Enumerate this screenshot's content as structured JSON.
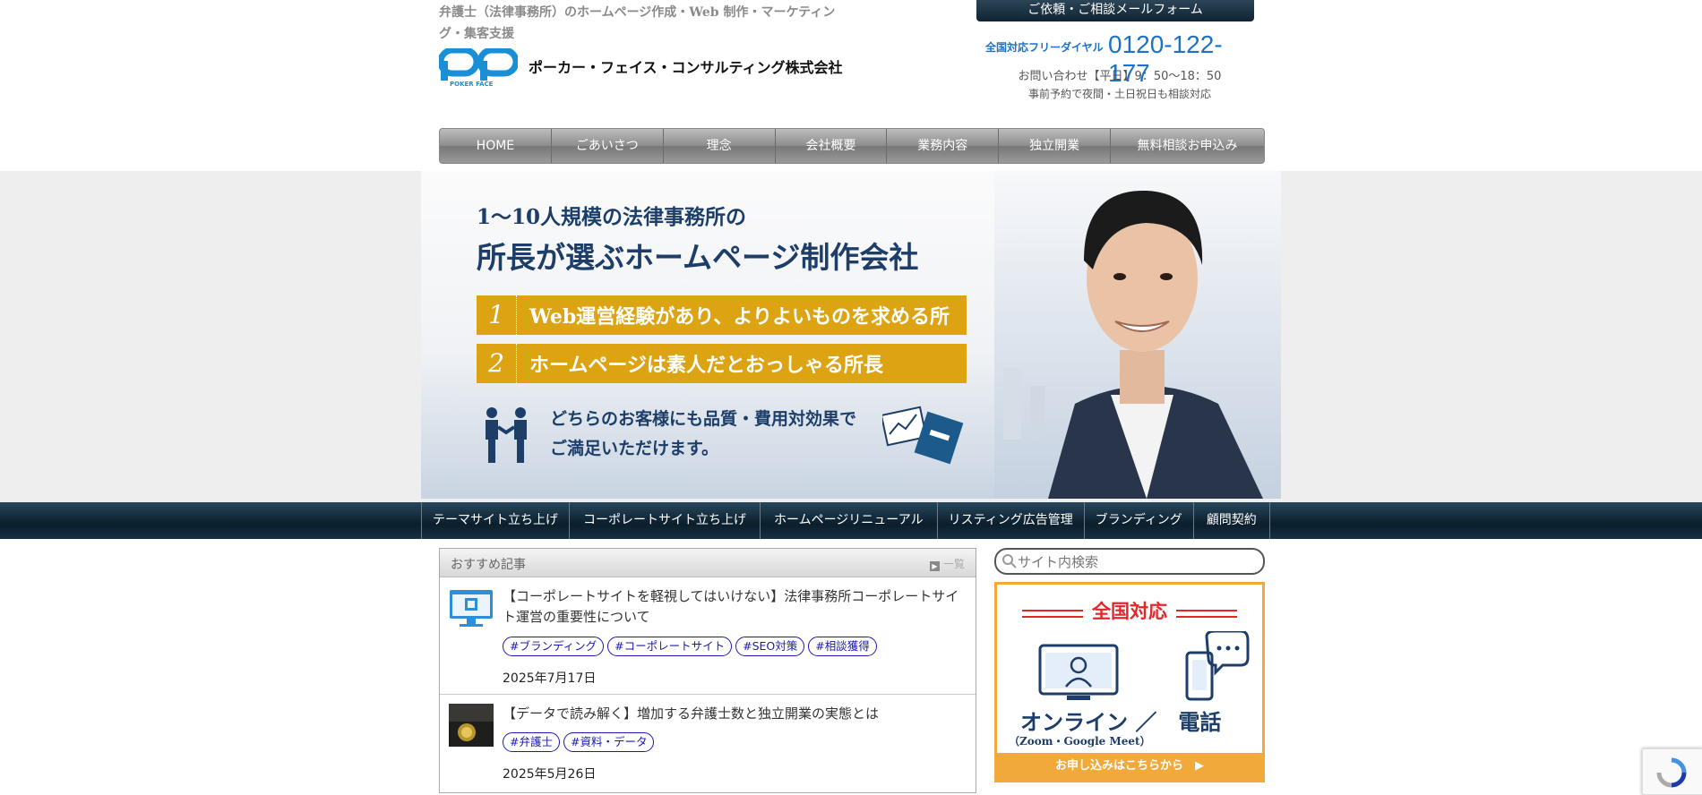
{
  "header": {
    "tagline": "弁護士（法律事務所）のホームページ作成・Web 制作・マーケティング・集客支援",
    "logo_text_top": "PP",
    "logo_text_bottom": "POKER FACE",
    "company_name": "ポーカー・フェイス・コンサルティング株式会社",
    "mail_button": "ご依頼・ご相談メールフォーム",
    "tel_label": "全国対応フリーダイヤル",
    "tel_number": "0120-122-177",
    "hours": "お問い合わせ【平日】9：50〜18：50",
    "hours_note": "事前予約で夜間・土日祝日も相談対応"
  },
  "nav": {
    "items": [
      "HOME",
      "ごあいさつ",
      "理念",
      "会社概要",
      "業務内容",
      "独立開業",
      "無料相談お申込み"
    ]
  },
  "hero": {
    "line1": "1〜10人規模の法律事務所の",
    "line2": "所長が選ぶホームページ制作会社",
    "points": [
      {
        "num": "1",
        "text": "Web運営経験があり、よりよいものを求める所長"
      },
      {
        "num": "2",
        "text": "ホームページは素人だとおっしゃる所長"
      }
    ],
    "closing1": "どちらのお客様にも品質・費用対効果で",
    "closing2": "ご満足いただけます。"
  },
  "categories": [
    "テーマサイト立ち上げ",
    "コーポレートサイト立ち上げ",
    "ホームページリニューアル",
    "リスティング広告管理",
    "ブランディング",
    "顧問契約"
  ],
  "recommended": {
    "title": "おすすめ記事",
    "more": "一覧",
    "posts": [
      {
        "title": "【コーポレートサイトを軽視してはいけない】法律事務所コーポレートサイト運営の重要性について",
        "tags": [
          "#ブランディング",
          "#コーポレートサイト",
          "#SEO対策",
          "#相談獲得"
        ],
        "date": "2025年7月17日"
      },
      {
        "title": "【データで読み解く】増加する弁護士数と独立開業の実態とは",
        "tags": [
          "#弁護士",
          "#資料・データ"
        ],
        "date": "2025年5月26日"
      }
    ]
  },
  "sidebar": {
    "search_placeholder": "サイト内検索",
    "banner_title": "全国対応",
    "banner_main": "オンライン ／　電話",
    "banner_sub": "（Zoom・Google Meet）",
    "banner_cta": "お申し込みはこちらから　▶"
  },
  "colors": {
    "accent_blue": "#1a73c8",
    "navy": "#1c3e69",
    "gold": "#dca413",
    "orange": "#f2a93b",
    "red": "#e3262a",
    "tag_blue": "#1919b3"
  }
}
